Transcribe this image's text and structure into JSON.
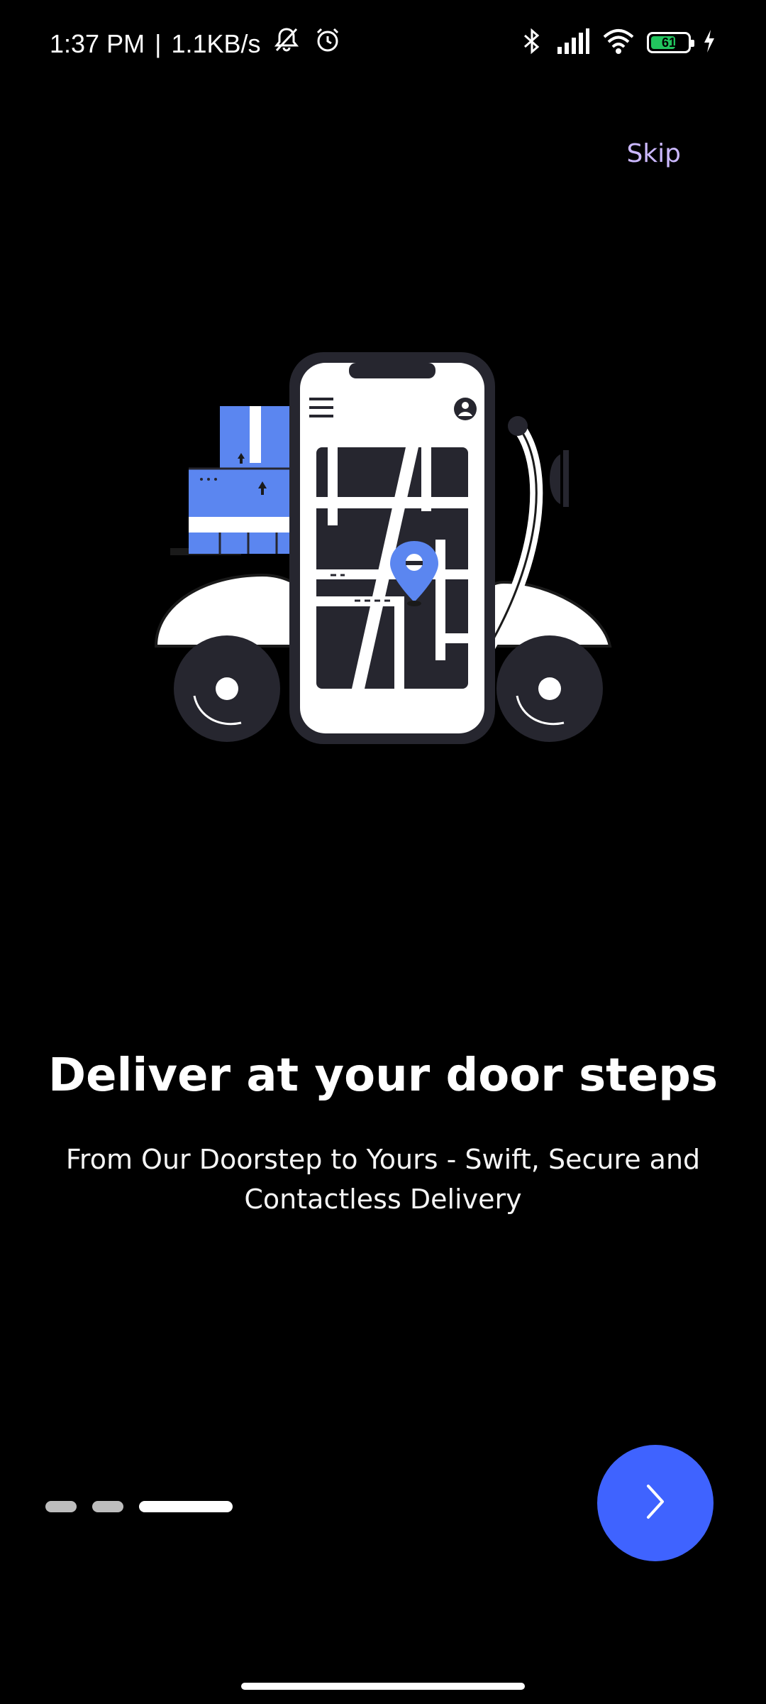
{
  "status_bar": {
    "time": "1:37 PM",
    "separator": "|",
    "network_speed": "1.1KB/s",
    "left_icons": [
      "muted-bell-icon",
      "alarm-icon"
    ],
    "right_icons": [
      "bluetooth-icon",
      "signal-icon",
      "wifi-icon",
      "battery-icon",
      "charging-icon"
    ],
    "battery_level": "61"
  },
  "onboarding": {
    "skip_label": "Skip",
    "illustration_icon": "delivery-scooter-phone-map-illustration",
    "title": "Deliver at your door steps",
    "subtitle": "From Our Doorstep to Yours - Swift, Secure and Contactless Delivery",
    "page_indicator": {
      "total": 3,
      "active_index": 2
    },
    "next_icon": "chevron-right-icon"
  },
  "colors": {
    "background": "#000000",
    "accent": "#3f63ff",
    "skip_text": "#cbb8ff",
    "illustration_blue": "#5b86f0",
    "illustration_dark": "#26262f"
  }
}
